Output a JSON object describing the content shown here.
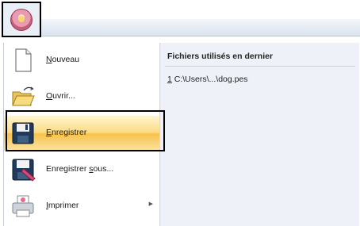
{
  "app_button": {
    "icon": "application-orb-icon"
  },
  "menu": {
    "items": [
      {
        "label": "Nouveau",
        "icon": "new-document-icon",
        "accel": "N"
      },
      {
        "label": "Ouvrir...",
        "icon": "open-folder-icon",
        "accel": "O"
      },
      {
        "label": "Enregistrer",
        "icon": "save-disk-icon",
        "accel": "E",
        "active": true
      },
      {
        "label": "Enregistrer sous...",
        "icon": "save-as-icon",
        "accel": "s"
      },
      {
        "label": "Imprimer",
        "icon": "printer-icon",
        "accel": "I",
        "has_submenu": true
      }
    ]
  },
  "recent": {
    "header": "Fichiers utilisés en dernier",
    "files": [
      {
        "index": "1",
        "path": "C:\\Users\\...\\dog.pes"
      }
    ]
  },
  "colors": {
    "highlight": "#fedb82",
    "panel_bg": "#eef2f8"
  }
}
